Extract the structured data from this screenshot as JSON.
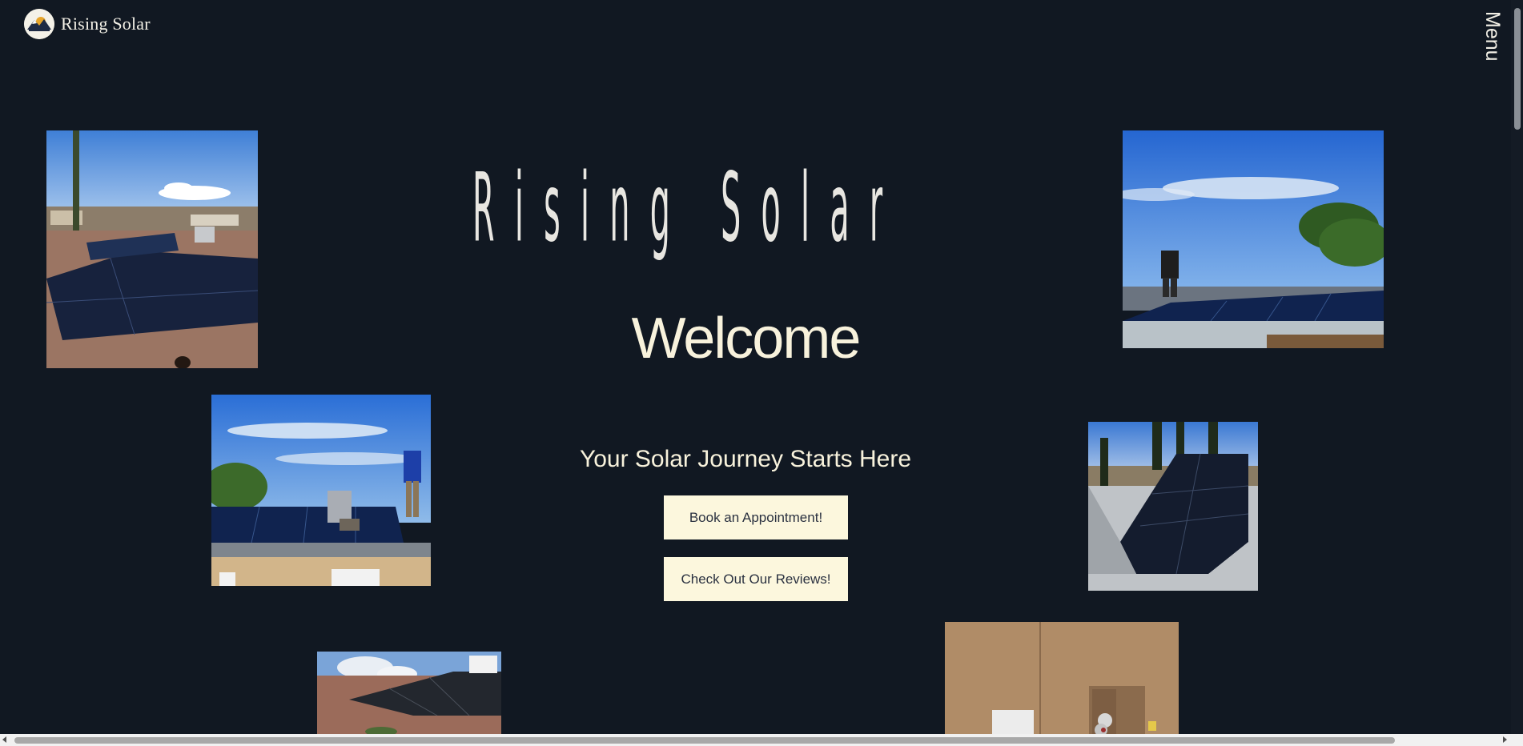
{
  "header": {
    "logo_text": "Rising Solar",
    "logo_icon": "sun-over-mountains-logo-icon",
    "menu_label": "Menu"
  },
  "hero": {
    "brand_title": "Rising Solar",
    "welcome": "Welcome",
    "tagline": "Your Solar Journey Starts Here"
  },
  "buttons": {
    "book": "Book an Appointment!",
    "reviews": "Check Out Our Reviews!"
  },
  "colors": {
    "background": "#111822",
    "cream_accent": "#fcf7dd",
    "title_text": "#e8e6e1"
  },
  "photos": [
    {
      "name": "photo-rooftop-panels-town"
    },
    {
      "name": "photo-worker-on-roof-trees"
    },
    {
      "name": "photo-two-workers-installing"
    },
    {
      "name": "photo-panels-with-cypress-trees"
    },
    {
      "name": "photo-tile-roof-panels"
    },
    {
      "name": "photo-electric-meter-wall"
    }
  ]
}
